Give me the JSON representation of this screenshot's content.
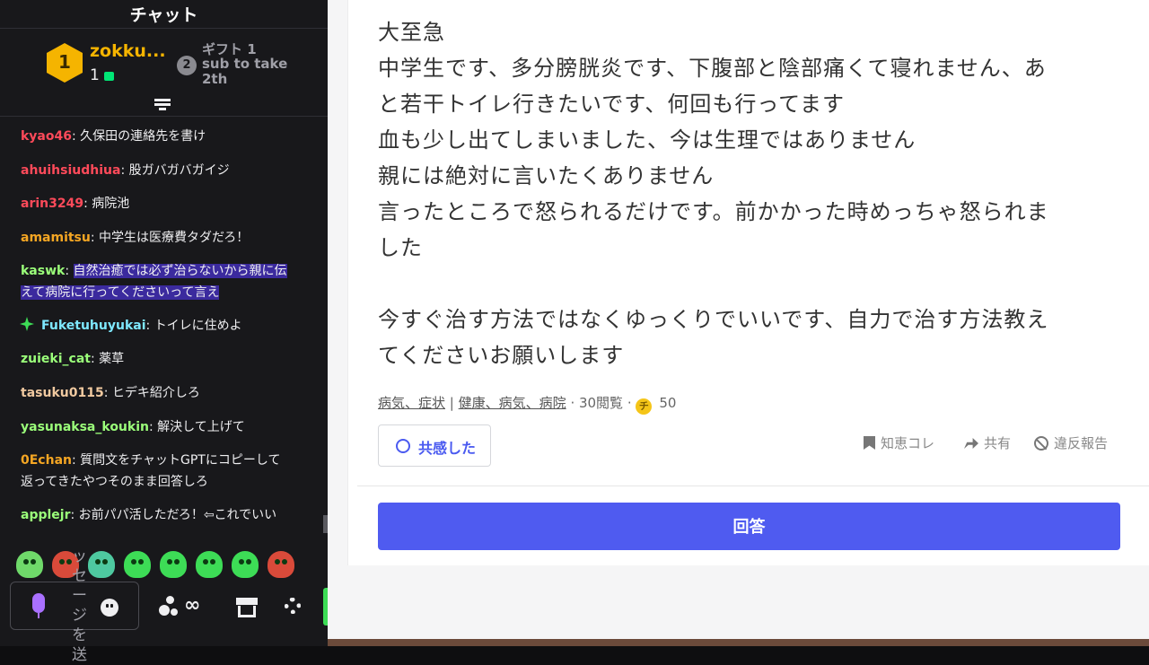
{
  "chat": {
    "title": "チャット",
    "leaders": [
      {
        "rank": "1",
        "name": "zokku...",
        "count": "1"
      },
      {
        "rank": "2",
        "line1": "ギフト 1",
        "line2": "sub to take",
        "line3": "2th"
      }
    ],
    "messages": [
      {
        "user": "kyao46",
        "color": "#ff4a5a",
        "text": "久保田の連絡先を書け"
      },
      {
        "user": "ahuihsiudhiua",
        "color": "#ff4a5a",
        "text": "股ガバガバガイジ"
      },
      {
        "user": "arin3249",
        "color": "#ff4a5a",
        "text": "病院池"
      },
      {
        "user": "amamitsu",
        "color": "#f5a623",
        "text": "中学生は医療費タダだろ！"
      },
      {
        "user": "kaswk",
        "color": "#9bff7a",
        "text_line1": "自然治癒では必ず治らないから親に伝",
        "text_line2": "えて病院に行ってくださいって言え"
      },
      {
        "user": "Fuketuhuyukai",
        "color": "#7ee8ff",
        "text": "トイレに住めよ"
      },
      {
        "user": "zuieki_cat",
        "color": "#9bff7a",
        "text": "薬草"
      },
      {
        "user": "tasuku0115",
        "color": "#f0c9a0",
        "text": "ヒデキ紹介しろ"
      },
      {
        "user": "yasunaksa_koukin",
        "color": "#9bff7a",
        "text": "解決して上げて"
      },
      {
        "user": "0Echan",
        "color": "#f5a623",
        "text_line1": "質問文をチャットGPTにコピーして",
        "text_line2": "返ってきたやつそのまま回答しろ"
      },
      {
        "user": "applejr",
        "color": "#9bff7a",
        "text": "お前パパ活しただろ！⇦これでいい"
      }
    ],
    "input_placeholder": "ッセージを送",
    "infinity": "∞",
    "icons": [
      "collapse-icon",
      "sparkle-icon",
      "mic-icon",
      "smile-icon",
      "bits-icon",
      "store-icon",
      "gear-icon"
    ]
  },
  "question": {
    "lines": [
      "大至急",
      "中学生です、多分膀胱炎です、下腹部と陰部痛くて寝れません、あ",
      "と若干トイレ行きたいです、何回も行ってます",
      "血も少し出てしまいました、今は生理ではありません",
      "親には絶対に言いたくありません",
      "言ったところで怒られるだけです。前かかった時めっちゃ怒られま",
      "した",
      "",
      "今すぐ治す方法ではなくゆっくりでいいです、自力で治す方法教え",
      "てくださいお願いします"
    ],
    "category1": "病気、症状",
    "separator": "|",
    "category2": "健康、病気、病院",
    "views": "· 30閲覧 ·",
    "coin_symbol": "チ",
    "coins": "50",
    "empathy_label": "共感した",
    "bookmark_label": "知恵コレ",
    "share_label": "共有",
    "report_label": "違反報告",
    "answer_label": "回答"
  }
}
